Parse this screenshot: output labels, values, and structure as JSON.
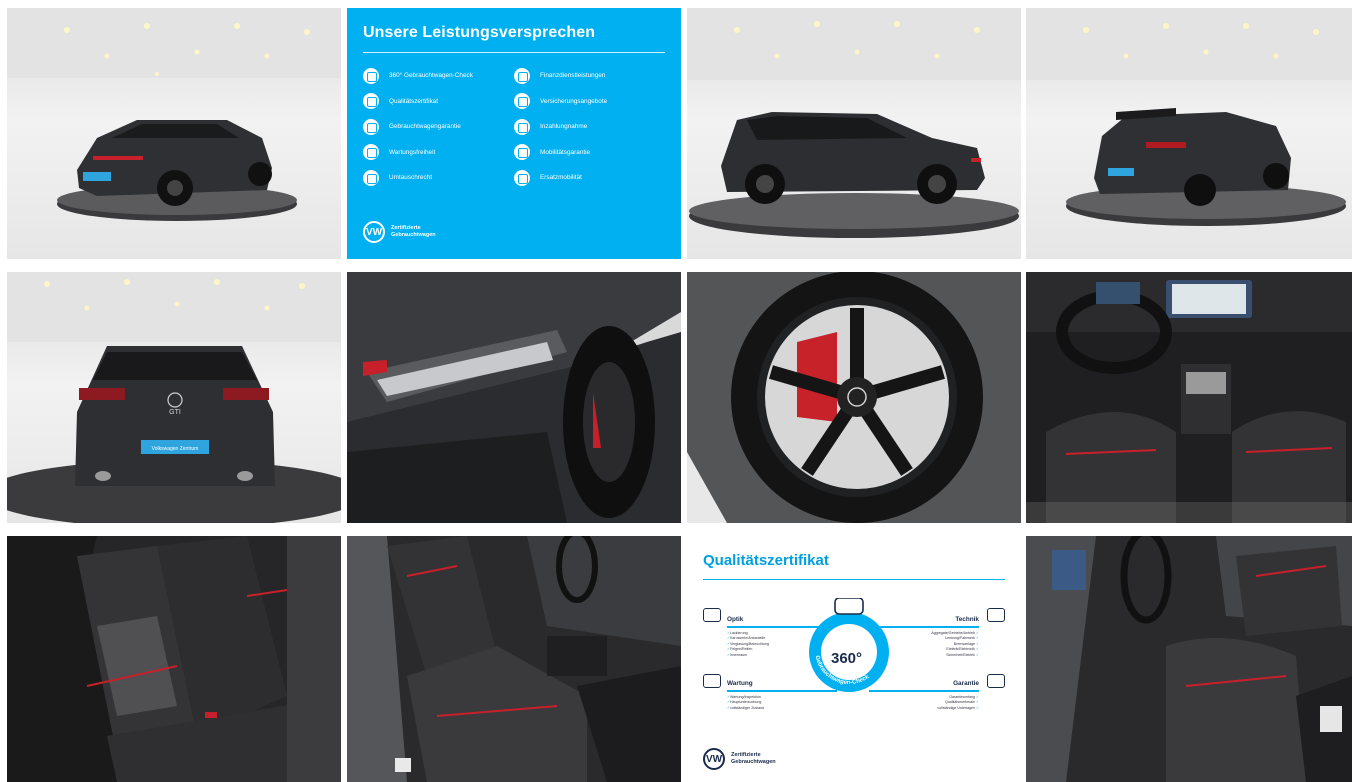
{
  "promise_panel": {
    "title": "Unsere Leistungsversprechen",
    "left_items": [
      "360° Gebrauchtwagen-Check",
      "Qualitätszertifikat",
      "Gebrauchtwagengarantie",
      "Wartungsfreiheit",
      "Umtauschrecht"
    ],
    "right_items": [
      "Finanzdienstleistungen",
      "Versicherungsangebote",
      "Inzahlungnahme",
      "Mobilitätsgarantie",
      "Ersatzmobilität"
    ],
    "logo_line1": "Zertifizierte",
    "logo_line2": "Gebrauchtwagen",
    "bg_color": "#00b0f0"
  },
  "cert_panel": {
    "title": "Qualitätszertifikat",
    "badge_number": "360°",
    "badge_ring_text": "Gebrauchtwagen-Check",
    "optik": {
      "head": "Optik",
      "items": [
        "Lackierung",
        "Karosserie/Anbauteile",
        "Verglasung/Beleuchtung",
        "Felgen/Reifen",
        "Innenraum"
      ]
    },
    "technik": {
      "head": "Technik",
      "items": [
        "Aggregate/Getriebe/Antrieb",
        "Lenkung/Fahrwerk",
        "Bremsanlage",
        "Elektrik/Elektronik",
        "Sicherheit/Elektrik"
      ]
    },
    "wartung": {
      "head": "Wartung",
      "items": [
        "Wartung/Inspektion",
        "Hauptuntersuchung",
        "vollständiger Zustand"
      ]
    },
    "garantie": {
      "head": "Garantie",
      "items": [
        "Garantieumfang",
        "Qualitätsmerkmale",
        "vollständige Unterlagen"
      ]
    },
    "logo_line1": "Zertifizierte",
    "logo_line2": "Gebrauchtwagen",
    "accent": "#00b0f0"
  },
  "plate_text": "Volkswagen Zentrum",
  "rear_badge": "GTI",
  "vw_mark": "VW"
}
